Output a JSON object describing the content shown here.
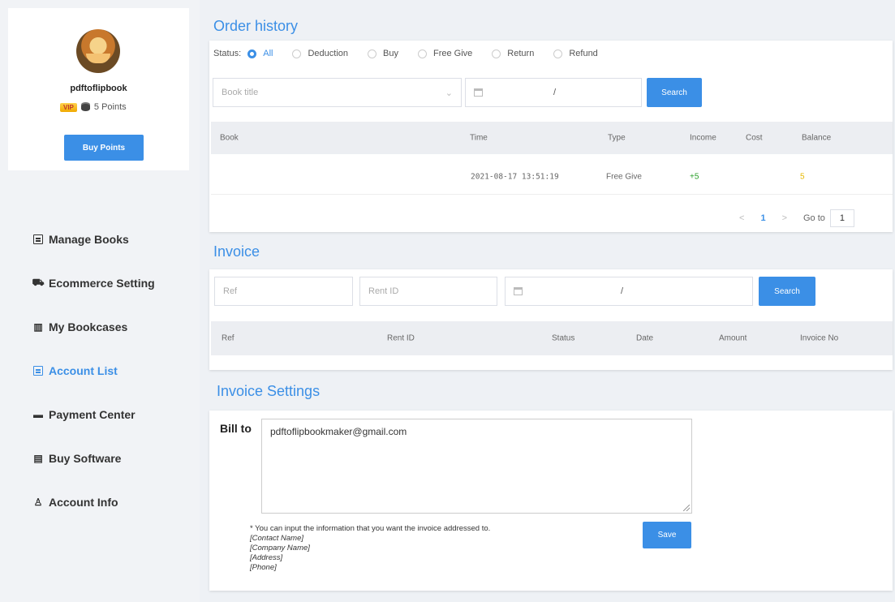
{
  "profile": {
    "username": "pdftoflipbook",
    "vip": "VIP",
    "points": "5 Points",
    "buy_points": "Buy Points"
  },
  "nav": [
    {
      "label": "Manage Books",
      "icon": "book-grid-icon"
    },
    {
      "label": "Ecommerce Setting",
      "icon": "cart-icon"
    },
    {
      "label": "My Bookcases",
      "icon": "bookcase-icon"
    },
    {
      "label": "Account List",
      "icon": "list-icon",
      "active": true
    },
    {
      "label": "Payment Center",
      "icon": "card-icon"
    },
    {
      "label": "Buy Software",
      "icon": "ticket-icon"
    },
    {
      "label": "Account Info",
      "icon": "user-icon"
    }
  ],
  "order_history": {
    "title": "Order history",
    "status_label": "Status:",
    "statuses": [
      "All",
      "Deduction",
      "Buy",
      "Free Give",
      "Return",
      "Refund"
    ],
    "selected_status": "All",
    "book_title_placeholder": "Book title",
    "date_separator": "/",
    "search": "Search",
    "columns": [
      "Book",
      "Time",
      "Type",
      "Income",
      "Cost",
      "Balance"
    ],
    "rows": [
      {
        "book": "",
        "time": "2021-08-17 13:51:19",
        "type": "Free Give",
        "income": "+5",
        "cost": "",
        "balance": "5"
      }
    ],
    "pager": {
      "prev": "<",
      "page": "1",
      "next": ">",
      "goto_label": "Go to",
      "goto_value": "1"
    }
  },
  "invoice": {
    "title": "Invoice",
    "ref_placeholder": "Ref",
    "rent_placeholder": "Rent ID",
    "date_separator": "/",
    "search": "Search",
    "columns": [
      "Ref",
      "Rent ID",
      "Status",
      "Date",
      "Amount",
      "Invoice No"
    ]
  },
  "invoice_settings": {
    "title": "Invoice Settings",
    "bill_to": "Bill to",
    "bill_value": "pdftoflipbookmaker@gmail.com",
    "hint": "* You can input the information that you want the invoice addressed to.",
    "hint_lines": [
      "[Contact Name]",
      "[Company Name]",
      "[Address]",
      "[Phone]"
    ],
    "save": "Save"
  },
  "colors": {
    "accent": "#3b8fe6",
    "income": "#2ca02c",
    "balance": "#e6b800"
  }
}
